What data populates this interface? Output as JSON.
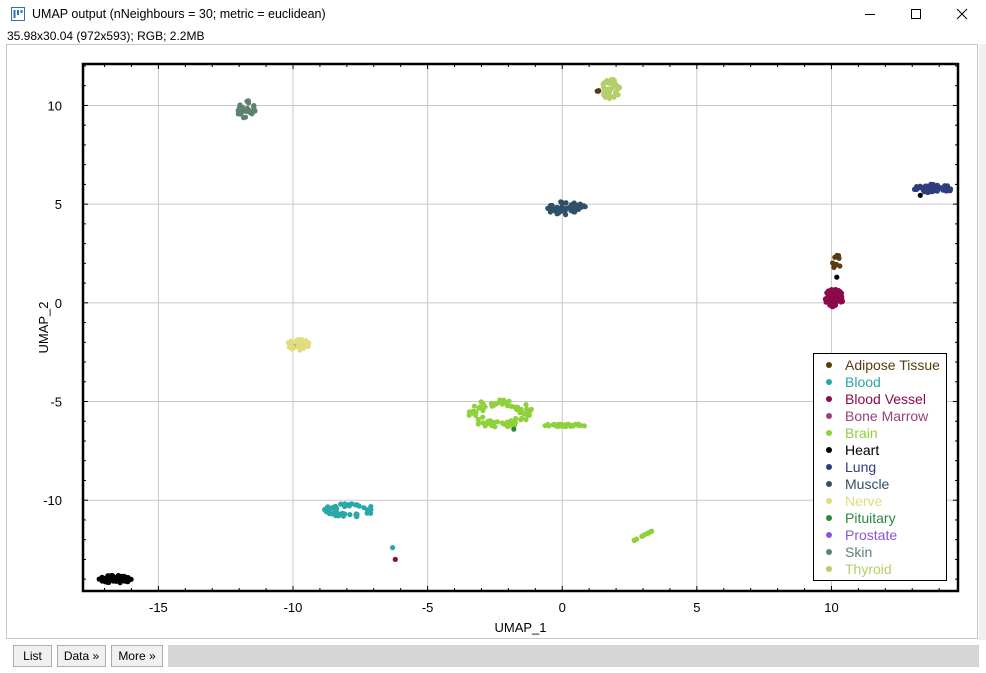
{
  "window": {
    "title": "UMAP output (nNeighbours = 30; metric = euclidean)",
    "info": "35.98x30.04  (972x593); RGB; 2.2MB",
    "minimize_icon": "minimize-icon",
    "maximize_icon": "maximize-icon",
    "close_icon": "close-icon"
  },
  "bottom": {
    "list_label": "List",
    "data_label": "Data »",
    "more_label": "More »"
  },
  "chart_data": {
    "type": "scatter",
    "xlabel": "UMAP_1",
    "ylabel": "UMAP_2",
    "xlim": [
      -17.8,
      14.7
    ],
    "ylim": [
      -14.6,
      12.1
    ],
    "xticks": [
      -15,
      -10,
      -5,
      0,
      5,
      10
    ],
    "yticks": [
      -10,
      -5,
      0,
      5,
      10
    ],
    "grid": true,
    "legend_position": "lower-right",
    "series": [
      {
        "name": "Adipose Tissue",
        "color": "#5b3a0f",
        "clusters": [
          {
            "cx": 1.4,
            "cy": 10.8,
            "rx": 0.15,
            "ry": 0.1,
            "n": 3
          },
          {
            "cx": 10.15,
            "cy": 2.1,
            "rx": 0.25,
            "ry": 0.35,
            "n": 10
          }
        ]
      },
      {
        "name": "Blood",
        "color": "#2aa7a7",
        "clusters": [
          {
            "cx": -7.9,
            "cy": -10.5,
            "rx": 0.95,
            "ry": 0.35,
            "n": 55,
            "ring": true
          },
          {
            "cx": -6.3,
            "cy": -12.4,
            "rx": 0.05,
            "ry": 0.05,
            "n": 1
          }
        ]
      },
      {
        "name": "Blood Vessel",
        "color": "#8b0a4a",
        "clusters": [
          {
            "cx": 10.1,
            "cy": 0.25,
            "rx": 0.35,
            "ry": 0.45,
            "n": 60
          },
          {
            "cx": -6.2,
            "cy": -13.0,
            "rx": 0.05,
            "ry": 0.05,
            "n": 1
          }
        ]
      },
      {
        "name": "Bone Marrow",
        "color": "#9a3f7a",
        "clusters": [
          {
            "cx": -9.95,
            "cy": -2.2,
            "rx": 0.05,
            "ry": 0.05,
            "n": 1
          }
        ]
      },
      {
        "name": "Brain",
        "color": "#8fd13a",
        "clusters": [
          {
            "cx": -2.3,
            "cy": -5.6,
            "rx": 1.2,
            "ry": 0.75,
            "n": 80,
            "ring": true
          },
          {
            "cx": 0.1,
            "cy": -6.2,
            "rx": 0.85,
            "ry": 0.07,
            "n": 30
          },
          {
            "cx": 3.0,
            "cy": -11.8,
            "rx": 0.35,
            "ry": 0.25,
            "n": 12,
            "line": true
          }
        ]
      },
      {
        "name": "Heart",
        "color": "#000000",
        "clusters": [
          {
            "cx": -16.6,
            "cy": -14.0,
            "rx": 0.6,
            "ry": 0.2,
            "n": 55
          },
          {
            "cx": 13.3,
            "cy": 5.45,
            "rx": 0.05,
            "ry": 0.05,
            "n": 1
          },
          {
            "cx": 10.2,
            "cy": 1.3,
            "rx": 0.05,
            "ry": 0.05,
            "n": 1
          }
        ]
      },
      {
        "name": "Lung",
        "color": "#2c3e7e",
        "clusters": [
          {
            "cx": 13.8,
            "cy": 5.8,
            "rx": 0.75,
            "ry": 0.22,
            "n": 60
          }
        ]
      },
      {
        "name": "Muscle",
        "color": "#2e5068",
        "clusters": [
          {
            "cx": 0.15,
            "cy": 4.8,
            "rx": 0.75,
            "ry": 0.35,
            "n": 55
          }
        ]
      },
      {
        "name": "Nerve",
        "color": "#e1dc80",
        "clusters": [
          {
            "cx": -9.8,
            "cy": -2.1,
            "rx": 0.45,
            "ry": 0.3,
            "n": 30
          }
        ]
      },
      {
        "name": "Pituitary",
        "color": "#2a8a3a",
        "clusters": [
          {
            "cx": -1.8,
            "cy": -6.4,
            "rx": 0.05,
            "ry": 0.05,
            "n": 1
          }
        ]
      },
      {
        "name": "Prostate",
        "color": "#8a55d6",
        "clusters": []
      },
      {
        "name": "Skin",
        "color": "#5e8270",
        "clusters": [
          {
            "cx": -11.75,
            "cy": 9.8,
            "rx": 0.35,
            "ry": 0.45,
            "n": 35
          }
        ]
      },
      {
        "name": "Thyroid",
        "color": "#b4cf6a",
        "clusters": [
          {
            "cx": 1.8,
            "cy": 10.8,
            "rx": 0.35,
            "ry": 0.55,
            "n": 45
          }
        ]
      }
    ]
  }
}
